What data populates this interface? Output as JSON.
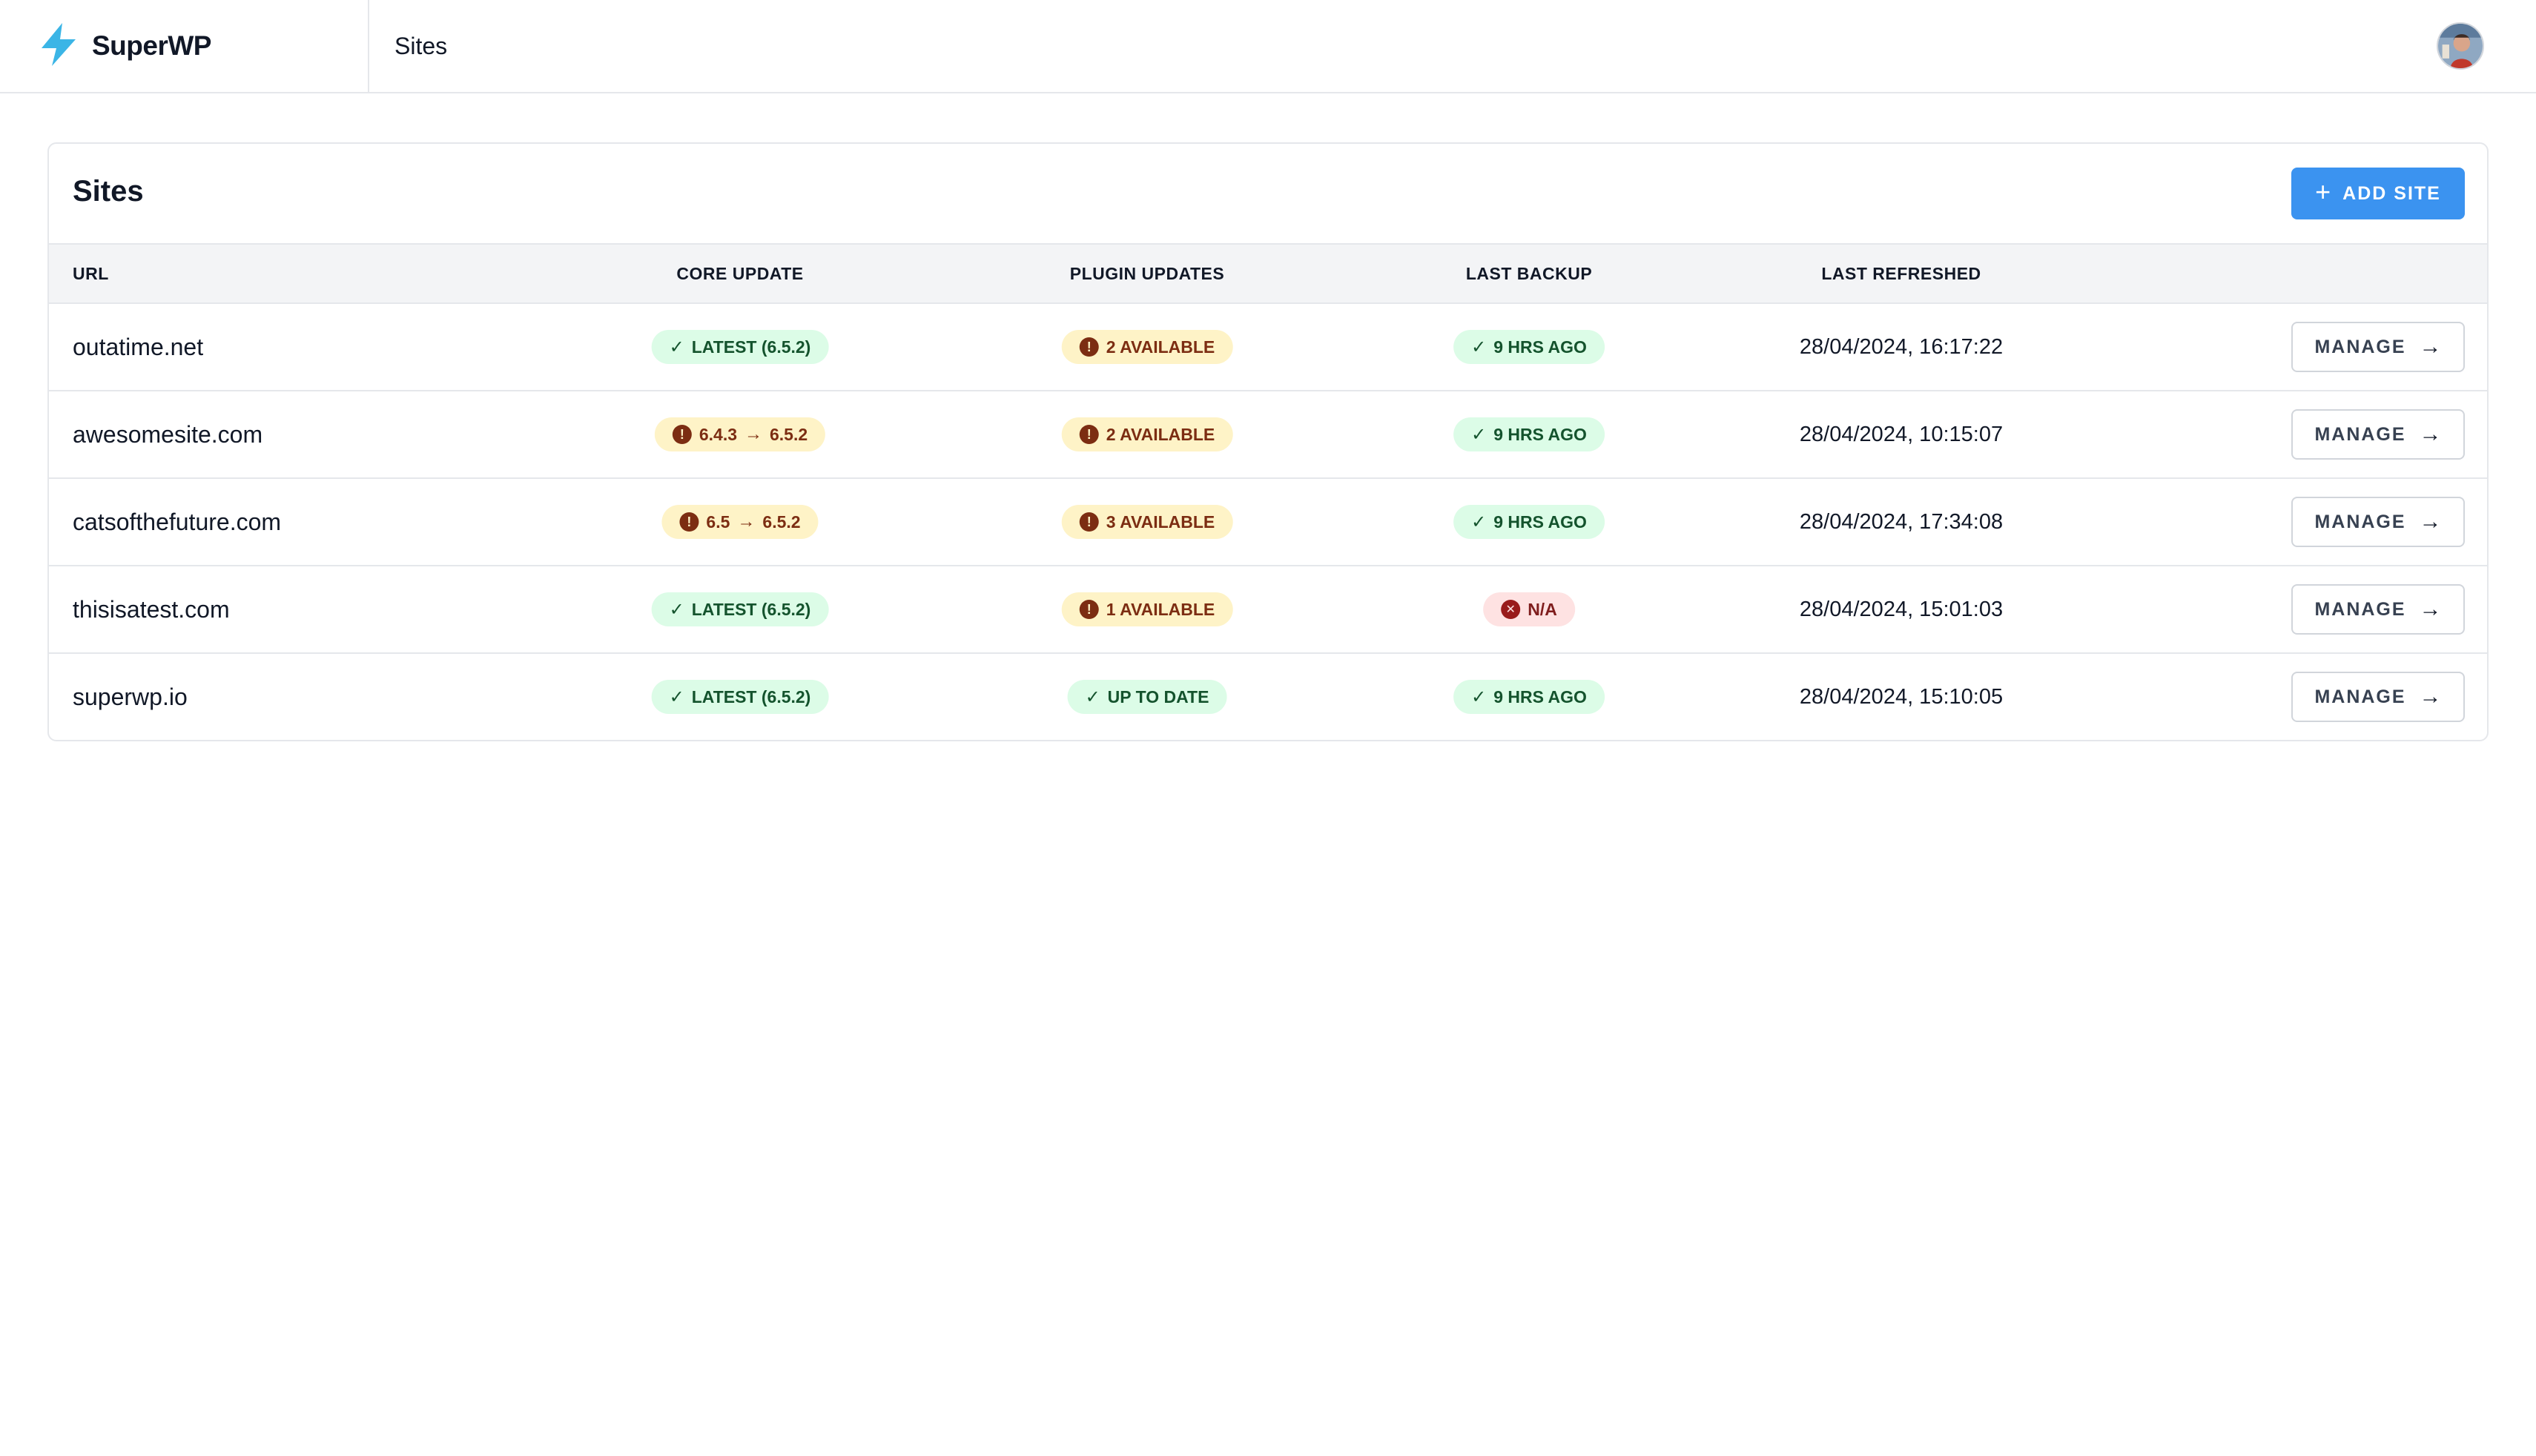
{
  "app": {
    "name": "SuperWP",
    "breadcrumb": "Sites",
    "logo_icon": "lightning-bolt-icon",
    "brand_color": "#3bb5e6"
  },
  "card": {
    "title": "Sites",
    "add_button": "ADD SITE",
    "accent": "#3b93f0"
  },
  "columns": {
    "url": "URL",
    "core": "CORE UPDATE",
    "plugin": "PLUGIN UPDATES",
    "backup": "LAST BACKUP",
    "refreshed": "LAST REFRESHED"
  },
  "rows": [
    {
      "url": "outatime.net",
      "core": {
        "status": "ok",
        "text": "LATEST (6.5.2)"
      },
      "plugin": {
        "status": "warn",
        "text": "2 AVAILABLE"
      },
      "backup": {
        "status": "ok",
        "text": "9 HRS AGO"
      },
      "refreshed": "28/04/2024, 16:17:22",
      "action": "MANAGE"
    },
    {
      "url": "awesomesite.com",
      "core": {
        "status": "warn",
        "from": "6.4.3",
        "to": "6.5.2"
      },
      "plugin": {
        "status": "warn",
        "text": "2 AVAILABLE"
      },
      "backup": {
        "status": "ok",
        "text": "9 HRS AGO"
      },
      "refreshed": "28/04/2024, 10:15:07",
      "action": "MANAGE"
    },
    {
      "url": "catsofthefuture.com",
      "core": {
        "status": "warn",
        "from": "6.5",
        "to": "6.5.2"
      },
      "plugin": {
        "status": "warn",
        "text": "3 AVAILABLE"
      },
      "backup": {
        "status": "ok",
        "text": "9 HRS AGO"
      },
      "refreshed": "28/04/2024, 17:34:08",
      "action": "MANAGE"
    },
    {
      "url": "thisisatest.com",
      "core": {
        "status": "ok",
        "text": "LATEST (6.5.2)"
      },
      "plugin": {
        "status": "warn",
        "text": "1 AVAILABLE"
      },
      "backup": {
        "status": "error",
        "text": "N/A"
      },
      "refreshed": "28/04/2024, 15:01:03",
      "action": "MANAGE"
    },
    {
      "url": "superwp.io",
      "core": {
        "status": "ok",
        "text": "LATEST (6.5.2)"
      },
      "plugin": {
        "status": "ok",
        "text": "UP TO DATE"
      },
      "backup": {
        "status": "ok",
        "text": "9 HRS AGO"
      },
      "refreshed": "28/04/2024, 15:10:05",
      "action": "MANAGE"
    }
  ],
  "status_colors": {
    "ok": "#dcfce7",
    "warn": "#fef3c7",
    "error": "#fee2e2"
  }
}
